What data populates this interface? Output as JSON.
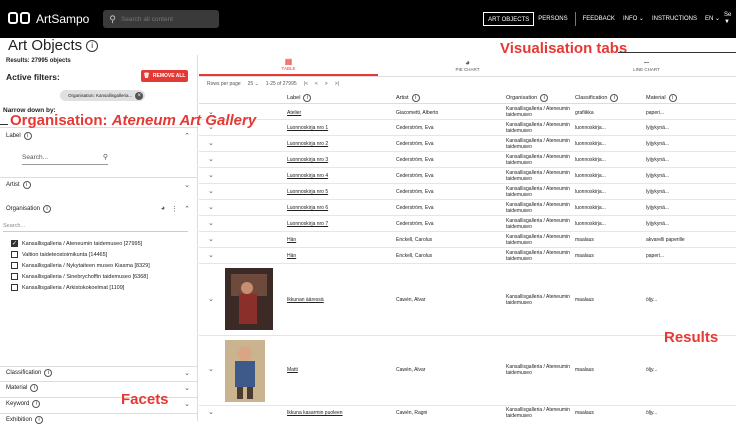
{
  "app": {
    "name": "ArtSampo"
  },
  "search": {
    "placeholder": "Search all content"
  },
  "nav": {
    "items": [
      "ART OBJECTS",
      "PERSONS",
      "FEEDBACK",
      "INFO ⌄",
      "INSTRUCTIONS",
      "EN ⌄"
    ],
    "active_index": 0,
    "corner_label": "Se"
  },
  "page": {
    "title": "Art Objects"
  },
  "facets": {
    "results": "Results: 27995 objects",
    "active_filters_title": "Active filters:",
    "remove_all": "REMOVE ALL",
    "chip": "Organisation: Kansallisgalleria...",
    "narrow_down": "Narrow down by:",
    "label_facet": "Label",
    "label_search_placeholder": "Search...",
    "artist_facet": "Artist",
    "organisation_facet": "Organisation",
    "org_search_placeholder": "Search...",
    "org_options": [
      {
        "label": "Kansallisgalleria / Ateneumin taidemuseo [27995]",
        "checked": true
      },
      {
        "label": "Valtion taideteostoimikunta [14465]",
        "checked": false
      },
      {
        "label": "Kansallisgalleria / Nykytaiteen museo Kiasma [8329]",
        "checked": false
      },
      {
        "label": "Kansallisgalleria / Sinebrychoffin taidemuseo [6368]",
        "checked": false
      },
      {
        "label": "Kansallisgalleria / Arkistokokoelmat [1109]",
        "checked": false
      }
    ],
    "bottom": [
      "Classification",
      "Material",
      "Keyword",
      "Exhibition"
    ]
  },
  "tabs": [
    {
      "label": "TABLE",
      "icon": "table-icon"
    },
    {
      "label": "PIE CHART",
      "icon": "pie-chart-icon"
    },
    {
      "label": "LINE CHART",
      "icon": "line-chart-icon"
    }
  ],
  "pager": {
    "rows_label": "Rows per page",
    "rows_value": "25 ⌄",
    "range": "1-25 of 27995",
    "first": "|<",
    "prev": "<",
    "next": ">",
    "last": ">|"
  },
  "table": {
    "columns": [
      "Label",
      "Artist",
      "Organisation",
      "Classification",
      "Material"
    ],
    "rows": [
      {
        "label": "Atelier",
        "artist": "Giacometti, Alberto",
        "org": "Kansallisgalleria / Ateneumin taidemuseo",
        "cls": "grafiikka",
        "mat": "paperi..."
      },
      {
        "label": "Luonnoskirja nro 1",
        "artist": "Cederström, Eva",
        "org": "Kansallisgalleria / Ateneumin taidemuseo",
        "cls": "luonnoskirja...",
        "mat": "lyijykynä..."
      },
      {
        "label": "Luonnoskirja nro 2",
        "artist": "Cederström, Eva",
        "org": "Kansallisgalleria / Ateneumin taidemuseo",
        "cls": "luonnoskirja...",
        "mat": "lyijykynä..."
      },
      {
        "label": "Luonnoskirja nro 3",
        "artist": "Cederström, Eva",
        "org": "Kansallisgalleria / Ateneumin taidemuseo",
        "cls": "luonnoskirja...",
        "mat": "lyijykynä..."
      },
      {
        "label": "Luonnoskirja nro 4",
        "artist": "Cederström, Eva",
        "org": "Kansallisgalleria / Ateneumin taidemuseo",
        "cls": "luonnoskirja...",
        "mat": "lyijykynä..."
      },
      {
        "label": "Luonnoskirja nro 5",
        "artist": "Cederström, Eva",
        "org": "Kansallisgalleria / Ateneumin taidemuseo",
        "cls": "luonnoskirja...",
        "mat": "lyijykynä..."
      },
      {
        "label": "Luonnoskirja nro 6",
        "artist": "Cederström, Eva",
        "org": "Kansallisgalleria / Ateneumin taidemuseo",
        "cls": "luonnoskirja...",
        "mat": "lyijykynä..."
      },
      {
        "label": "Luonnoskirja nro 7",
        "artist": "Cederström, Eva",
        "org": "Kansallisgalleria / Ateneumin taidemuseo",
        "cls": "luonnoskirja...",
        "mat": "lyijykynä..."
      },
      {
        "label": "Hän",
        "artist": "Enckell, Carolus",
        "org": "Kansallisgalleria / Ateneumin taidemuseo",
        "cls": "maalaus",
        "mat": "akvarelli paperille"
      },
      {
        "label": "Hän",
        "artist": "Enckell, Carolus",
        "org": "Kansallisgalleria / Ateneumin taidemuseo",
        "cls": "maalaus",
        "mat": "paperi..."
      },
      {
        "label": "Ikkunan ääressä",
        "artist": "Cawén, Alvar",
        "org": "Kansallisgalleria / Ateneumin taidemuseo",
        "cls": "maalaus",
        "mat": "öljy..."
      },
      {
        "label": "Matti",
        "artist": "Cawén, Alvar",
        "org": "Kansallisgalleria / Ateneumin taidemuseo",
        "cls": "maalaus",
        "mat": "öljy..."
      },
      {
        "label": "Ikkuna kasarmin puoleen",
        "artist": "Cawén, Ragni",
        "org": "Kansallisgalleria / Ateneumin taidemuseo",
        "cls": "maalaus",
        "mat": "öljy..."
      }
    ]
  },
  "annotations": {
    "visualisation": "Visualisation tabs",
    "organisation_prefix": "Organisation: ",
    "organisation_value": "Ateneum Art Gallery",
    "results": "Results",
    "facets": "Facets"
  },
  "colors": {
    "accent": "#e53935",
    "topbar": "#000000"
  }
}
